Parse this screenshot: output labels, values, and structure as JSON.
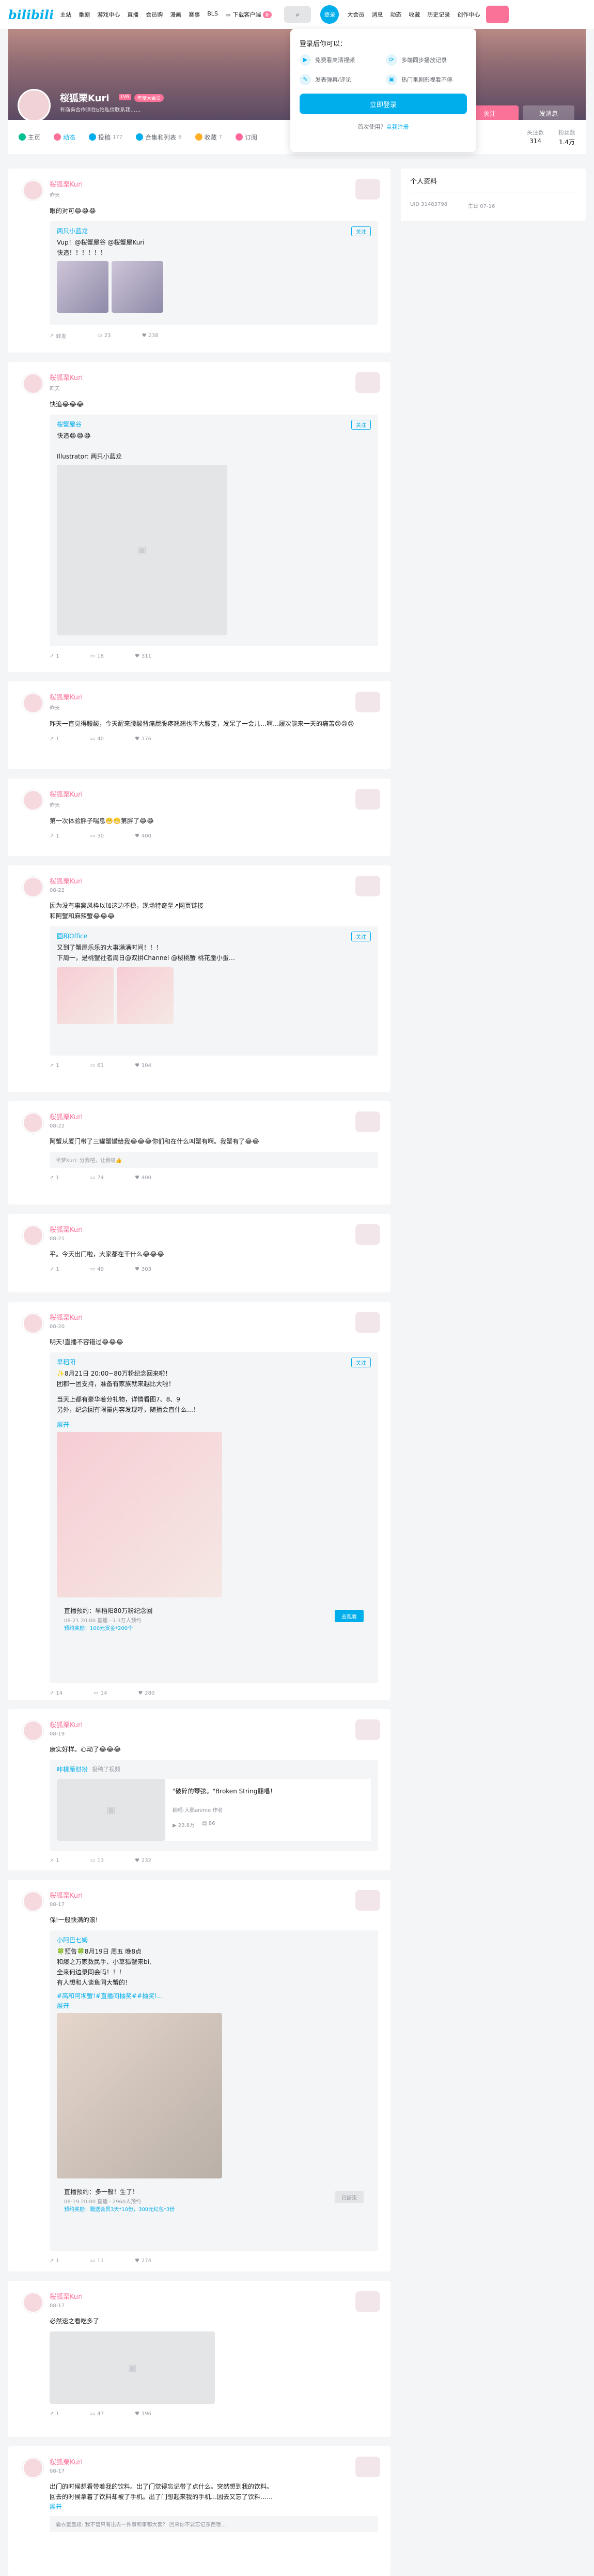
{
  "header": {
    "logo": "bilibili",
    "nav": [
      "主站",
      "番剧",
      "游戏中心",
      "直播",
      "会员购",
      "漫画",
      "赛事",
      "BLS"
    ],
    "download": "下载客户端",
    "badge": "新",
    "login": "登录",
    "right": [
      "大会员",
      "消息",
      "动态",
      "收藏",
      "历史记录",
      "创作中心"
    ]
  },
  "popup": {
    "title": "登录后你可以：",
    "items": [
      "免费看高清视频",
      "多端同步播放记录",
      "发表弹幕/评论",
      "热门番剧影视看不停"
    ],
    "button": "立即登录",
    "register_prefix": "首次使用？",
    "register_link": "点我注册"
  },
  "profile": {
    "name": "桜狐栗Kuri",
    "level": "LV6",
    "vip": "年度大会员",
    "sign": "有商务合作请在b站私信联系我……",
    "follow": "关注",
    "message": "发消息"
  },
  "tabs": [
    {
      "label": "主页",
      "count": ""
    },
    {
      "label": "动态",
      "count": ""
    },
    {
      "label": "投稿",
      "count": "177"
    },
    {
      "label": "合集和列表",
      "count": "6"
    },
    {
      "label": "收藏",
      "count": "7"
    },
    {
      "label": "订阅",
      "count": ""
    }
  ],
  "stats": [
    {
      "label": "关注数",
      "value": "314"
    },
    {
      "label": "粉丝数",
      "value": "1.4万"
    }
  ],
  "side": {
    "title": "个人资料",
    "uid_label": "UID",
    "uid": "31483798",
    "birth_label": "生日",
    "birth": "07-16"
  },
  "posts": [
    {
      "name": "桜狐栗Kuri",
      "date": "昨天",
      "text": "眼的对可😂😂😂",
      "fw_user": "两只小蓝龙",
      "fw_text": "Vup！@桜蟹屋谷 @桜蟹屋Kuri",
      "fw_text2": "快追！！！！！！",
      "tag": "关注",
      "acts": [
        "转发",
        "23",
        "238"
      ]
    },
    {
      "name": "桜狐栗Kuri",
      "date": "昨天",
      "text": "快追😂😂😂",
      "fw_user": "桜蟹屋谷",
      "fw_text": "快追😂😂😂",
      "fw_text2": "Illustrator: 两只小蓝龙",
      "tag": "关注",
      "acts": [
        "1",
        "18",
        "311"
      ]
    },
    {
      "name": "桜狐栗Kuri",
      "date": "昨天",
      "text": "昨天一直觉得腰酸，今天醒来腰酸背痛屁股疼翘翘也不大腰变，发呆了一会儿…啊…履次能来一天的痛苦😢😢😢",
      "acts": [
        "1",
        "40",
        "176"
      ]
    },
    {
      "name": "桜狐栗Kuri",
      "date": "昨天",
      "text": "第一次体验胖子喘息😬😬第胖了😂😂",
      "acts": [
        "1",
        "30",
        "400"
      ]
    },
    {
      "name": "桜狐栗Kuri",
      "date": "08-22",
      "text": "因为没有事窝风枠以加这边不稳，现场特奇至↗网页链接",
      "text2": "和阿蟹和麻辣蟹😂😂😂",
      "fw_user": "圆和Office",
      "fw_text": "又到了蟹屋乐乐的大事满满时间！！！",
      "fw_text2": "下周一，是桃蟹社者周日@双拼Channel @桜桃蟹 桃花蜃小蛋…",
      "tag": "关注",
      "acts": [
        "1",
        "61",
        "104"
      ]
    },
    {
      "name": "桜狐栗Kuri",
      "date": "08-22",
      "text": "阿蟹从厦门带了三罐蟹罐给我😂😂😂你们和在什么叫蟹有啊。我蟹有了😂😂",
      "comment": "半梦Kuri: 分我吧，让我吸👍",
      "acts": [
        "1",
        "74",
        "400"
      ]
    },
    {
      "name": "桜狐栗Kuri",
      "date": "08-21",
      "text": "平。今天出门啦，大家都在干什么😂😂😂",
      "acts": [
        "1",
        "49",
        "303"
      ]
    },
    {
      "name": "桜狐栗Kuri",
      "date": "08-20",
      "text": "明天!直播不容错过😂😂😂",
      "fw_user": "早稻阳",
      "fw_text": "✨8月21日 20:00~80万粉纪念回来啦！",
      "fw_text2": "团都一团支持，准备有家族就来越比大啦！",
      "fw_text3": "当天上都有豪华着分礼物，详情看图7、8、9",
      "fw_text4": "另外，纪念回有限量内容发现呼，随播会直什么…！",
      "more": "展开",
      "live_title": "直播预约：早稻阳80万粉纪念回",
      "live_sub": "08-21 20:00 直播 · 1.3万人预约",
      "live_sub2": "预约奖励：100元赏金*200个",
      "live_btn": "去观看",
      "tag": "关注",
      "acts": [
        "14",
        "14",
        "280"
      ]
    },
    {
      "name": "桜狐栗Kuri",
      "date": "08-19",
      "text": "康实好样。心动了😂😂😂",
      "fw_user": "咔桃蜃怼扮",
      "fw_label": "投稿了视频",
      "video_title": "\"破碎的琴弦。\"Broken String翻唱！",
      "video_sub": "翻唱·大鹏anime 作者",
      "video_n1": "23.8万",
      "video_n2": "86",
      "acts": [
        "1",
        "13",
        "232"
      ]
    },
    {
      "name": "桜狐栗Kuri",
      "date": "08-17",
      "text": "保!一般快满的滚!",
      "fw_user": "小阿巴七姆",
      "fw_text": "🍀预告🍀8月19日 周五 晚8点",
      "fw_text2": "和爆之万家数民手、小草狐蟹来bi,",
      "fw_text3": "全来何边录同会吗！！！",
      "fw_text4": "有人想和人谈鱼同大蟹的！",
      "fw_text5": "#高和阿坝蟹!#直播间抽奖##抽奖!...",
      "more": "展开",
      "live_title": "直播预约：多一般！生了！",
      "live_sub": "08-19 20:00 直播 · 2960人预约",
      "live_sub2": "预约奖励：赠送会员3天*10份，300元红包*3份",
      "live_btn": "已结束",
      "acts": [
        "1",
        "11",
        "274"
      ]
    },
    {
      "name": "桜狐栗Kuri",
      "date": "08-17",
      "text": "必然速之看吃多了",
      "acts": [
        "1",
        "47",
        "196"
      ]
    },
    {
      "name": "桜狐栗Kuri",
      "date": "08-17",
      "text": "出门的时候想看带着我的饮料。出了门觉得忘记带了点什么。突然想到我的饮料。",
      "text2": "回去的时候拿着了饮料却被了手机。出了门想起来我的手机…因去又忘了饮料……",
      "more": "展开",
      "comment": "囊衣蟹蛊极: 我不管只有出去一件事和事都大套？ 回来你不要忘记东西哦…",
      "acts": [
        "",
        "",
        ""
      ]
    }
  ]
}
